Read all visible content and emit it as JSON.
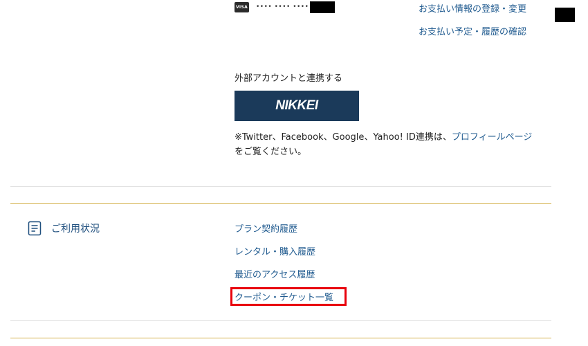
{
  "payment": {
    "card_brand": "VISA",
    "card_masked": "•••• •••• ••••",
    "register_link": "お支払い情報の登録・変更",
    "schedule_link": "お支払い予定・履歴の確認"
  },
  "external_account": {
    "label": "外部アカウントと連携する",
    "nikkei_button": "NIKKEI",
    "note_prefix": "※Twitter、Facebook、Google、Yahoo! ID連携は、",
    "note_link": "プロフィールページ",
    "note_suffix": "をご覧ください。"
  },
  "usage": {
    "title": "ご利用状況",
    "links": [
      "プラン契約履歴",
      "レンタル・購入履歴",
      "最近のアクセス履歴",
      "クーポン・チケット一覧"
    ]
  },
  "colors": {
    "link": "#1f5a8f",
    "nikkei_bg": "#1b3a5a",
    "gold_divider": "#d3b04a",
    "highlight": "#e8000b"
  }
}
